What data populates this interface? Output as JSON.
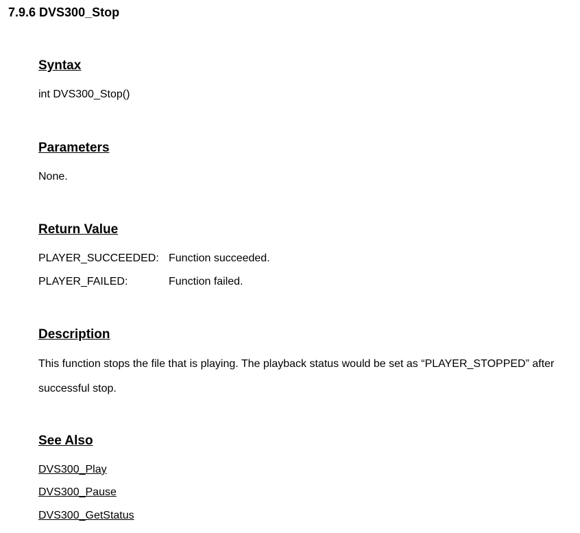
{
  "header": {
    "number_title": "7.9.6 DVS300_Stop"
  },
  "syntax": {
    "heading": "Syntax",
    "code": "int DVS300_Stop()"
  },
  "parameters": {
    "heading": "Parameters",
    "text": "None."
  },
  "return_value": {
    "heading": "Return Value",
    "rows": [
      {
        "key": "PLAYER_SUCCEEDED:",
        "val": "Function succeeded."
      },
      {
        "key": "PLAYER_FAILED:",
        "val": "Function failed."
      }
    ]
  },
  "description": {
    "heading": "Description",
    "text": "This function stops the file that is playing. The playback status would be set as “PLAYER_STOPPED” after successful stop."
  },
  "see_also": {
    "heading": "See Also",
    "links": [
      "DVS300_Play",
      "DVS300_Pause",
      "DVS300_GetStatus"
    ]
  }
}
